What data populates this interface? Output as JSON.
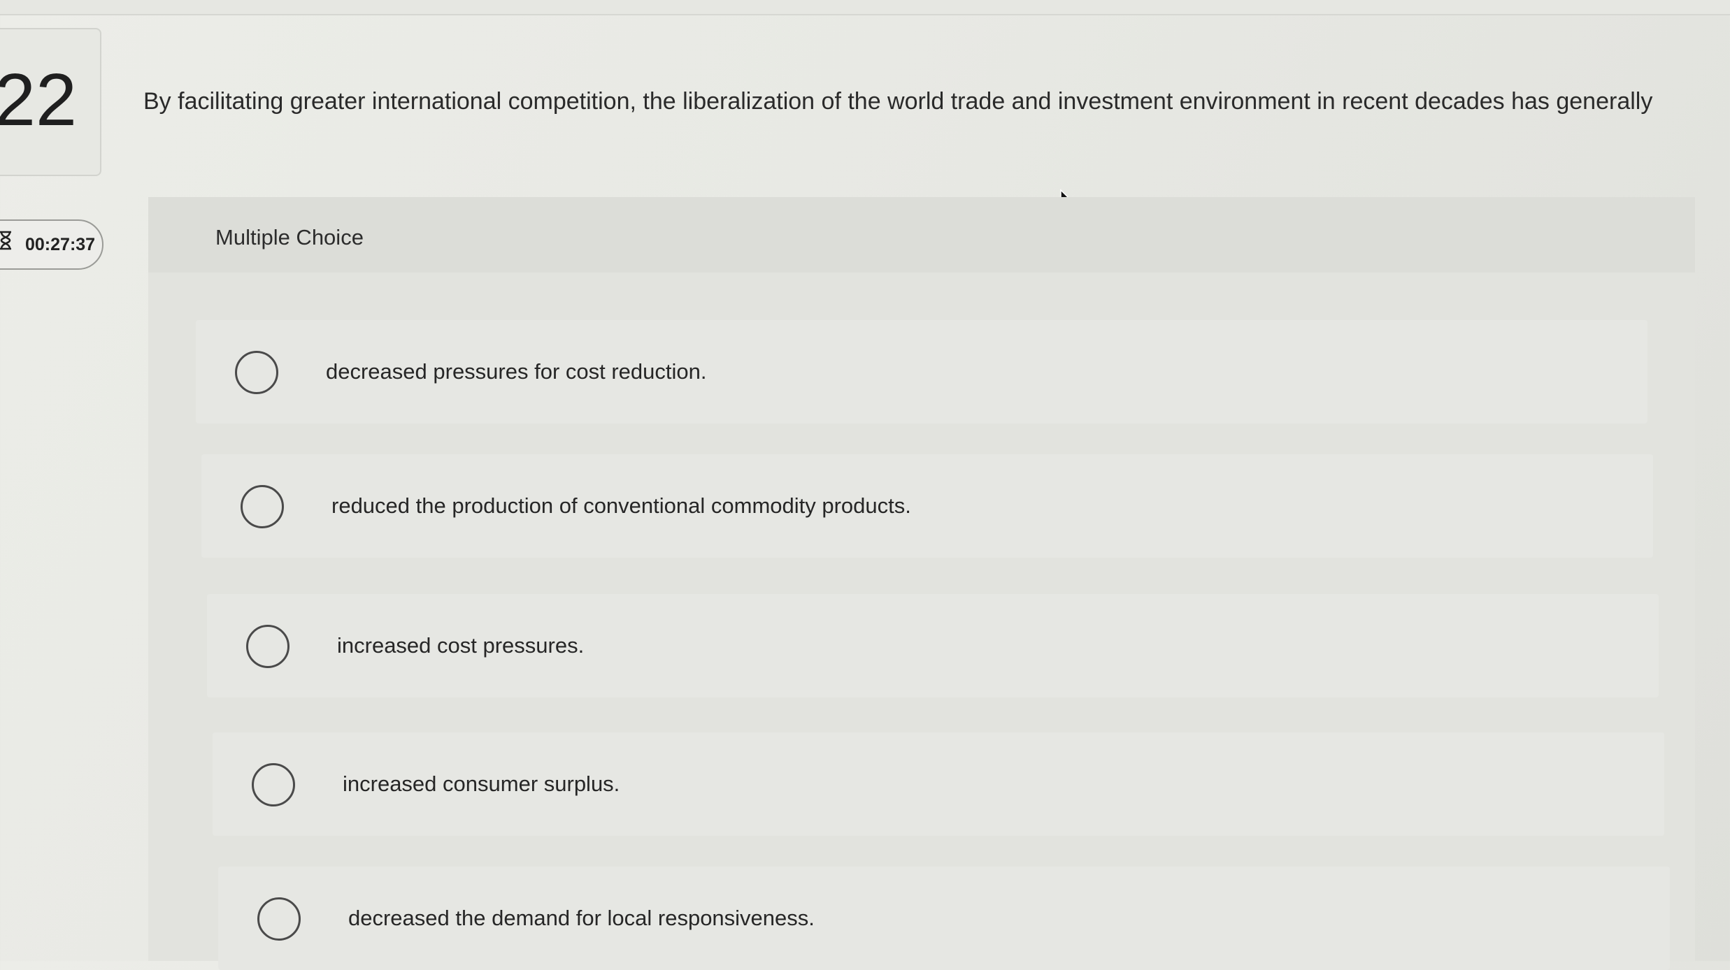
{
  "question": {
    "number": "22",
    "timer": "00:27:37",
    "text": "By facilitating greater international competition, the liberalization of the world trade and investment environment in recent decades has generally"
  },
  "panel": {
    "type_label": "Multiple Choice",
    "options": [
      {
        "label": "decreased pressures for cost reduction."
      },
      {
        "label": "reduced the production of conventional commodity products."
      },
      {
        "label": "increased cost pressures."
      },
      {
        "label": "increased consumer surplus."
      },
      {
        "label": "decreased the demand for local responsiveness."
      }
    ]
  },
  "icons": {
    "timer": "hourglass-icon",
    "cursor": "mouse-pointer-icon",
    "radio": "radio-unselected-icon"
  },
  "colors": {
    "background": "#e8e9e4",
    "panel": "#e2e3de",
    "text": "#2a2a2a"
  }
}
